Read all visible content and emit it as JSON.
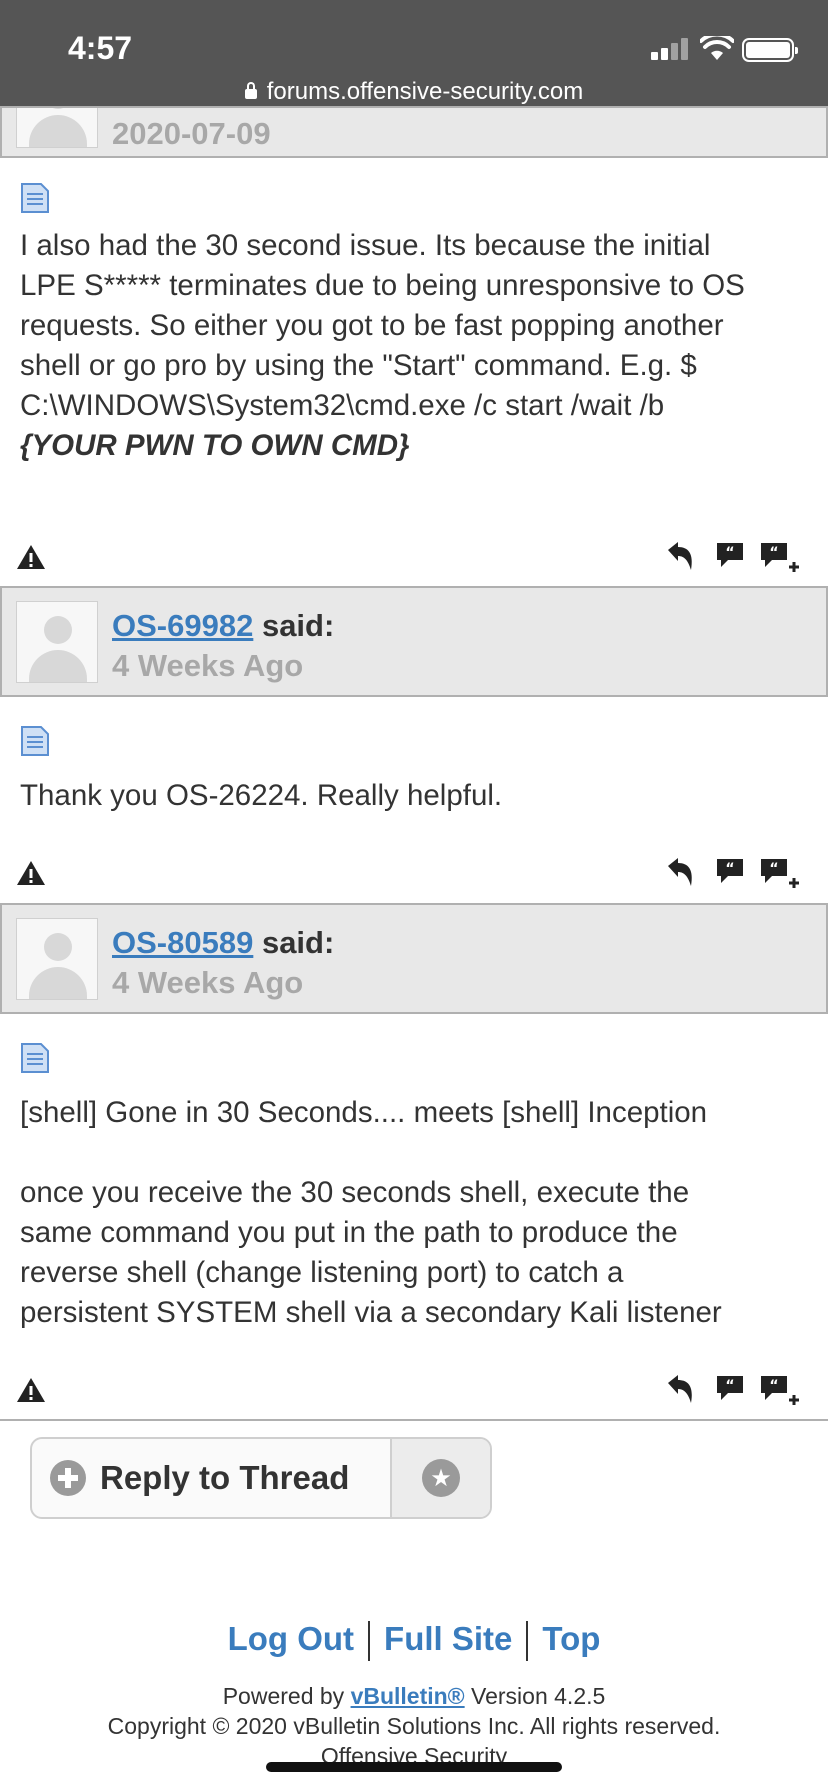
{
  "status_bar": {
    "time": "4:57",
    "url": "forums.offensive-security.com"
  },
  "posts": [
    {
      "date": "2020-07-09",
      "body_lines": [
        "I also had the 30 second issue. Its because the initial",
        "LPE S***** terminates due to being unresponsive to OS",
        "requests. So either you got to be fast popping another",
        "shell or go pro by using the \"Start\" command. E.g. $",
        "C:\\WINDOWS\\System32\\cmd.exe /c start /wait /b"
      ],
      "body_emphasis": "{YOUR PWN TO OWN CMD}"
    },
    {
      "username": "OS-69982",
      "said": "said:",
      "date": "4 Weeks Ago",
      "body_lines": [
        "Thank you OS-26224. Really helpful."
      ]
    },
    {
      "username": "OS-80589",
      "said": "said:",
      "date": "4 Weeks Ago",
      "body_lines": [
        "[shell] Gone in 30 Seconds.... meets [shell] Inception",
        "",
        "once you receive the 30 seconds shell, execute the",
        "same command you put in the path to produce the",
        "reverse shell (change listening port) to catch a",
        "persistent SYSTEM shell via a secondary Kali listener"
      ]
    }
  ],
  "post_actions": [
    "report-icon",
    "reply-icon",
    "quote-icon",
    "multi-quote-icon"
  ],
  "reply_button": {
    "label": "Reply to Thread"
  },
  "footer": {
    "links": [
      "Log Out",
      "Full Site",
      "Top"
    ],
    "powered_prefix": "Powered by",
    "powered_link": "vBulletin®",
    "powered_suffix": "Version 4.2.5",
    "copyright": "Copyright © 2020 vBulletin Solutions Inc. All rights reserved.",
    "company": "Offensive Security"
  },
  "colors": {
    "status_bar": "#555555",
    "link": "#3a7cbd",
    "header_bg": "#e8e8e8",
    "date_gray": "#a8a8a8"
  }
}
